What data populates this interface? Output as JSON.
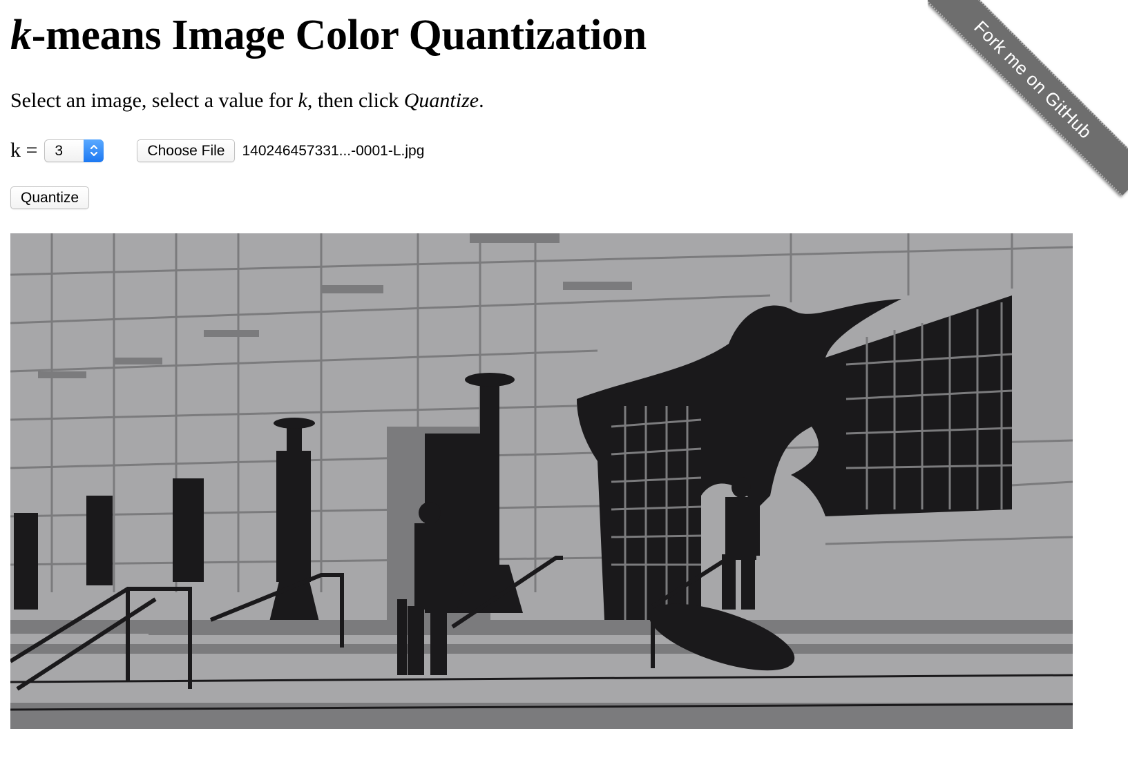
{
  "page": {
    "title_italic": "k",
    "title_rest": "-means Image Color Quantization",
    "instructions": {
      "part1": "Select an image, select a value for ",
      "k": "k",
      "part2": ", then click ",
      "action": "Quantize",
      "part3": "."
    }
  },
  "controls": {
    "k_label": "k =",
    "k_value": "3",
    "choose_file_label": "Choose File",
    "file_name": "140246457331...-0001-L.jpg",
    "quantize_label": "Quantize"
  },
  "ribbon": {
    "text": "Fork me on GitHub"
  },
  "output_image": {
    "palette": [
      "#1a191b",
      "#7b7b7d",
      "#a7a7a9"
    ]
  }
}
